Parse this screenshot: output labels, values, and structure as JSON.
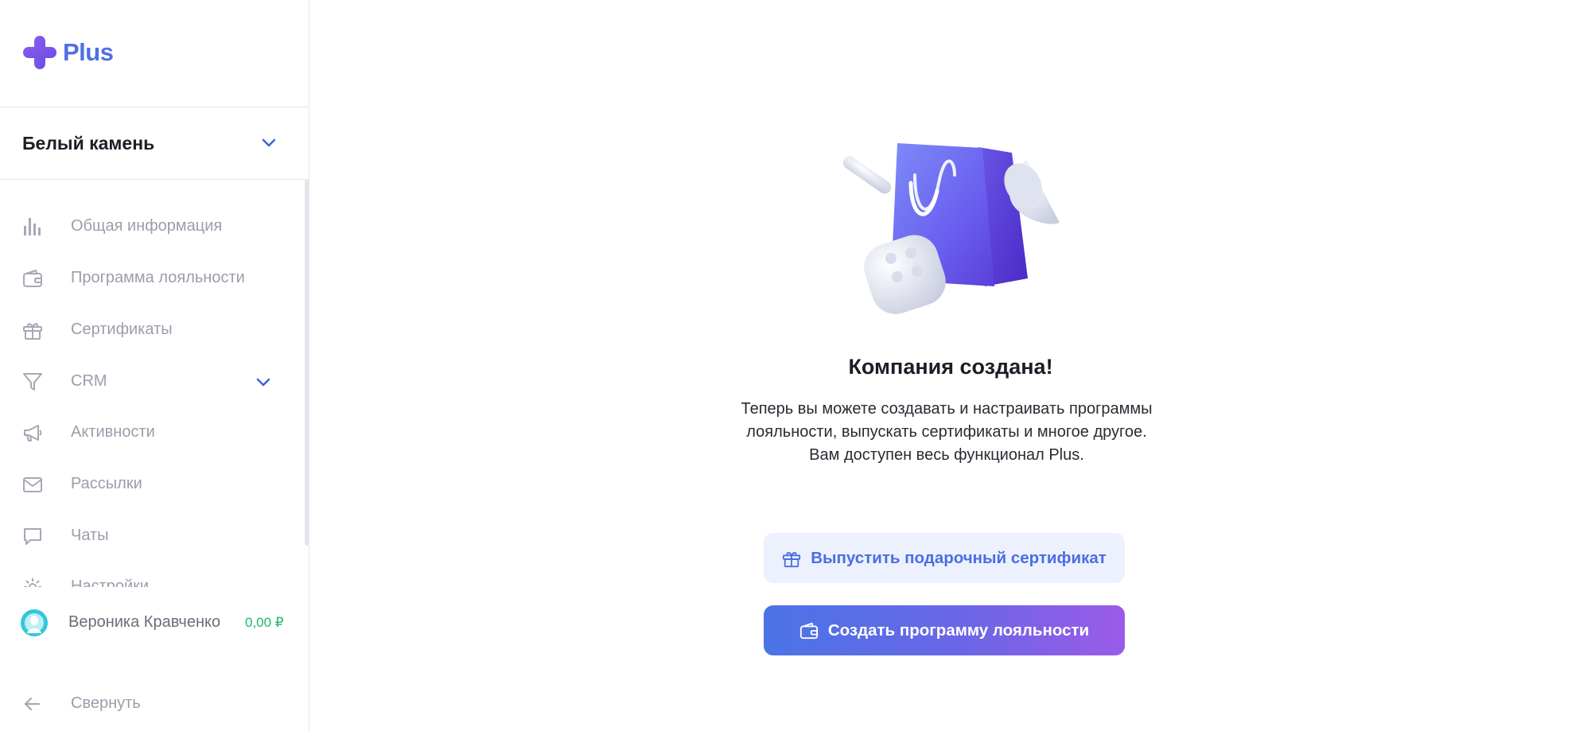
{
  "app": {
    "logo_text": "Plus",
    "brand_color": "#4f6fe6",
    "accent_purple": "#7c4ee4"
  },
  "company": {
    "name": "Белый камень"
  },
  "nav": {
    "items": [
      {
        "label": "Общая информация",
        "icon": "bar-chart-icon"
      },
      {
        "label": "Программа лояльности",
        "icon": "wallet-icon"
      },
      {
        "label": "Сертификаты",
        "icon": "gift-icon"
      },
      {
        "label": "CRM",
        "icon": "funnel-icon",
        "expandable": true
      },
      {
        "label": "Активности",
        "icon": "megaphone-icon"
      },
      {
        "label": "Рассылки",
        "icon": "mail-icon"
      },
      {
        "label": "Чаты",
        "icon": "chat-icon"
      },
      {
        "label": "Настройки",
        "icon": "gear-icon"
      }
    ]
  },
  "user": {
    "name": "Вероника Кравченко",
    "balance": "0,00 ₽",
    "balance_color": "#1cb86a"
  },
  "collapse": {
    "label": "Свернуть"
  },
  "main": {
    "title": "Компания создана!",
    "description_lines": [
      "Теперь вы можете создавать и настраивать программы",
      "лояльности, выпускать сертификаты и многое другое.",
      "Вам доступен весь функционал Plus."
    ],
    "secondary_button": "Выпустить подарочный сертификат",
    "primary_button": "Создать программу лояльности"
  }
}
